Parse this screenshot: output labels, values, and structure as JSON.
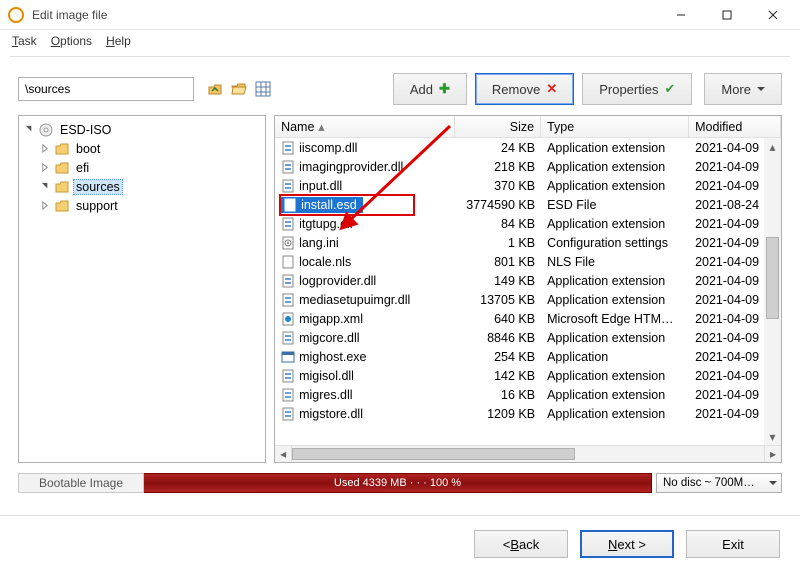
{
  "window": {
    "title": "Edit image file"
  },
  "menu": {
    "task": "Task",
    "options": "Options",
    "help": "Help"
  },
  "path": "\\sources",
  "toolbar": {
    "add": "Add",
    "remove": "Remove",
    "properties": "Properties",
    "more": "More"
  },
  "tree": {
    "root": "ESD-ISO",
    "items": [
      "boot",
      "efi",
      "sources",
      "support"
    ],
    "selected_index": 2
  },
  "columns": {
    "name": "Name",
    "size": "Size",
    "type": "Type",
    "modified": "Modified"
  },
  "files": [
    {
      "name": "iiscomp.dll",
      "size": "24 KB",
      "type": "Application extension",
      "modified": "2021-04-09 …",
      "icon": "dll"
    },
    {
      "name": "imagingprovider.dll",
      "size": "218 KB",
      "type": "Application extension",
      "modified": "2021-04-09 …",
      "icon": "dll"
    },
    {
      "name": "input.dll",
      "size": "370 KB",
      "type": "Application extension",
      "modified": "2021-04-09 …",
      "icon": "dll"
    },
    {
      "name": "install.esd",
      "size": "3774590 KB",
      "type": "ESD File",
      "modified": "2021-08-24 …",
      "icon": "file",
      "selected": true
    },
    {
      "name": "itgtupg.dll",
      "size": "84 KB",
      "type": "Application extension",
      "modified": "2021-04-09 …",
      "icon": "dll"
    },
    {
      "name": "lang.ini",
      "size": "1 KB",
      "type": "Configuration settings",
      "modified": "2021-04-09 …",
      "icon": "ini"
    },
    {
      "name": "locale.nls",
      "size": "801 KB",
      "type": "NLS File",
      "modified": "2021-04-09 …",
      "icon": "file"
    },
    {
      "name": "logprovider.dll",
      "size": "149 KB",
      "type": "Application extension",
      "modified": "2021-04-09 …",
      "icon": "dll"
    },
    {
      "name": "mediasetupuimgr.dll",
      "size": "13705 KB",
      "type": "Application extension",
      "modified": "2021-04-09 …",
      "icon": "dll"
    },
    {
      "name": "migapp.xml",
      "size": "640 KB",
      "type": "Microsoft Edge HTM…",
      "modified": "2021-04-09 …",
      "icon": "xml"
    },
    {
      "name": "migcore.dll",
      "size": "8846 KB",
      "type": "Application extension",
      "modified": "2021-04-09 …",
      "icon": "dll"
    },
    {
      "name": "mighost.exe",
      "size": "254 KB",
      "type": "Application",
      "modified": "2021-04-09 …",
      "icon": "exe"
    },
    {
      "name": "migisol.dll",
      "size": "142 KB",
      "type": "Application extension",
      "modified": "2021-04-09 …",
      "icon": "dll"
    },
    {
      "name": "migres.dll",
      "size": "16 KB",
      "type": "Application extension",
      "modified": "2021-04-09 …",
      "icon": "dll"
    },
    {
      "name": "migstore.dll",
      "size": "1209 KB",
      "type": "Application extension",
      "modified": "2021-04-09 …",
      "icon": "dll"
    }
  ],
  "status": {
    "label": "Bootable Image",
    "progress_text": "Used  4339 MB  · · ·  100 %",
    "disc": "No disc ~ 700M…"
  },
  "footer": {
    "back": "< Back",
    "next": "Next >",
    "exit": "Exit"
  }
}
